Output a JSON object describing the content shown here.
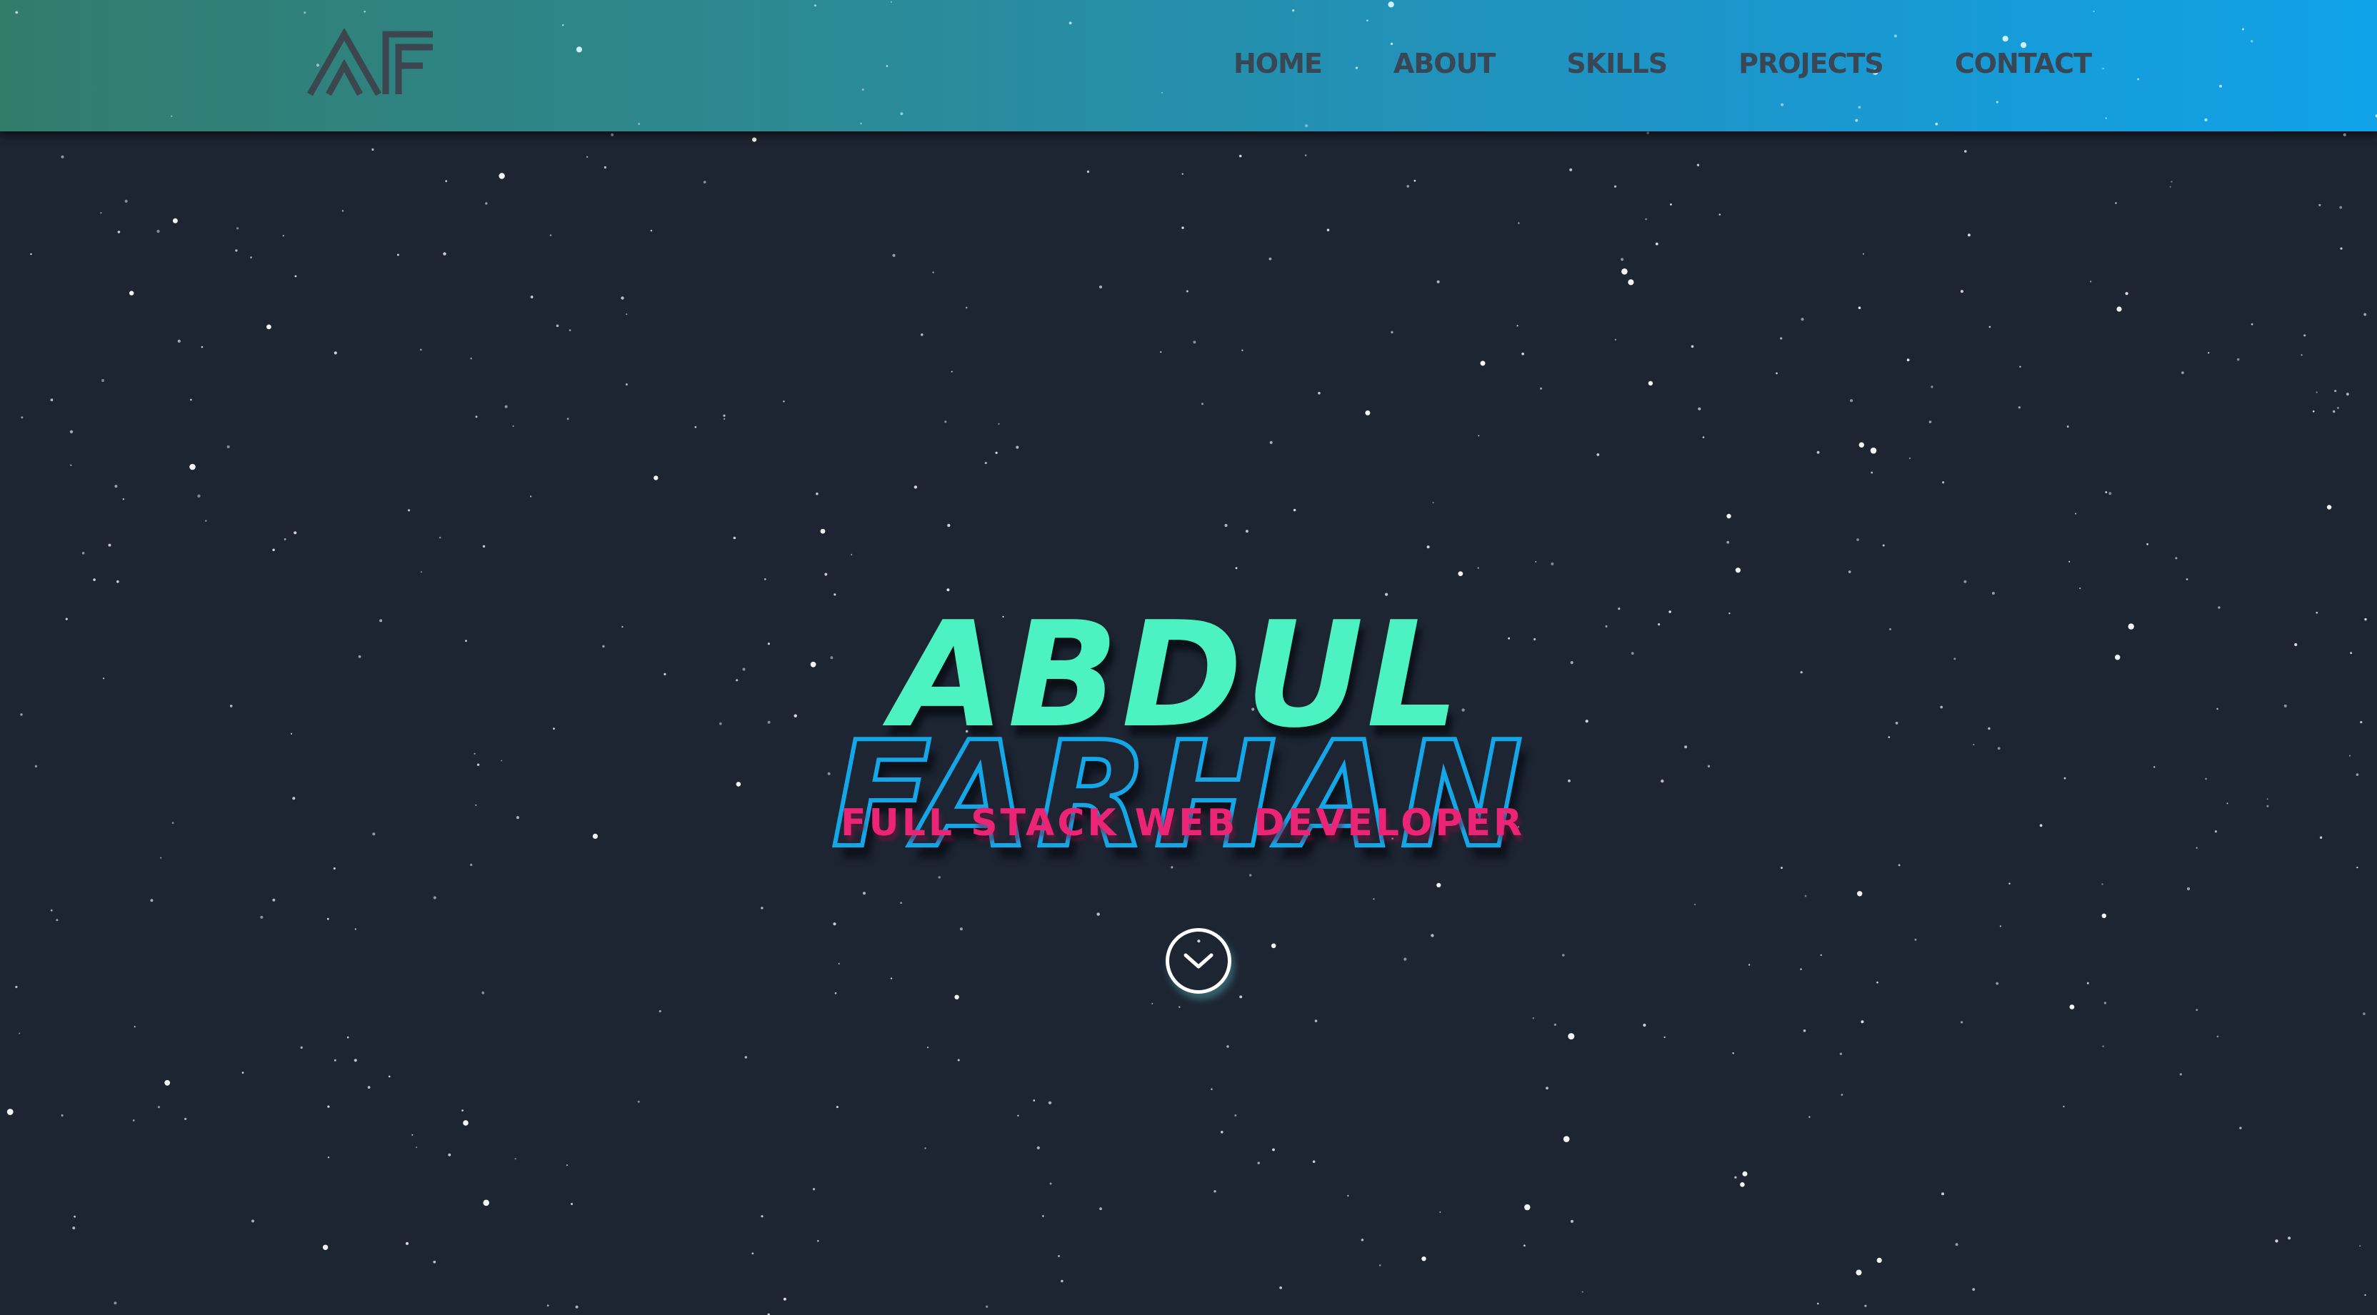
{
  "app": {
    "logo_text": "AF"
  },
  "nav": {
    "items": [
      {
        "label": "HOME"
      },
      {
        "label": "ABOUT"
      },
      {
        "label": "SKILLS"
      },
      {
        "label": "PROJECTS"
      },
      {
        "label": "CONTACT"
      }
    ]
  },
  "hero": {
    "first_name": "ABDUL",
    "last_name": "FARHAN",
    "tagline": "FULL STACK WEB DEVELOPER",
    "scroll_icon": "chevron-down-icon"
  },
  "colors": {
    "background": "#1d2533",
    "nav_gradient_start": "#327c6c",
    "nav_gradient_end": "#10a2e8",
    "nav_text": "#394654",
    "first_name": "#4cf2c2",
    "last_name_outline": "#14a6e6",
    "tagline": "#ec2476",
    "scroll_button": "#ffffff"
  }
}
